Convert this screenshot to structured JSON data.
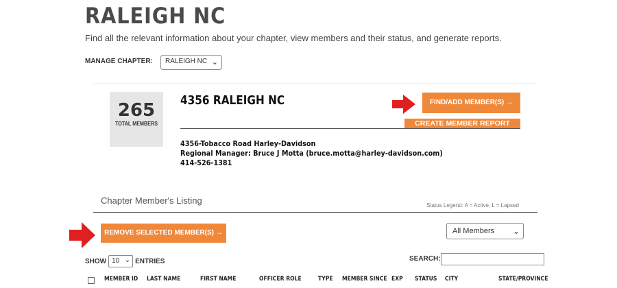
{
  "header": {
    "title": "RALEIGH NC",
    "description": "Find all the relevant information about your chapter, view members and their status, and generate reports."
  },
  "manage": {
    "label": "MANAGE CHAPTER:",
    "selected": "RALEIGH NC"
  },
  "stats": {
    "count": "265",
    "label": "TOTAL MEMBERS"
  },
  "chapter": {
    "name": "4356 RALEIGH NC",
    "dealer": "4356-Tobacco Road Harley-Davidson",
    "manager": "Regional Manager: Bruce J Motta (bruce.motta@harley-davidson.com)",
    "phone": "414-526-1381"
  },
  "actions": {
    "find_add": "FIND/ADD MEMBER(S) →",
    "create_report": "CREATE MEMBER REPORT",
    "remove_selected": "REMOVE SELECTED MEMBER(S) →"
  },
  "listing": {
    "title": "Chapter Member's Listing",
    "legend": "Status Legend: A = Active, L = Lapsed",
    "filter_selected": "All Members"
  },
  "table_controls": {
    "show_label": "SHOW",
    "entries_value": "10",
    "entries_label": "ENTRIES",
    "search_label": "SEARCH:",
    "search_value": ""
  },
  "columns": [
    "MEMBER ID",
    "LAST NAME",
    "FIRST NAME",
    "OFFICER ROLE",
    "TYPE",
    "MEMBER SINCE",
    "EXP",
    "STATUS",
    "CITY",
    "STATE/PROVINCE"
  ],
  "colors": {
    "accent_orange": "#f0883a",
    "arrow_red": "#e02020"
  },
  "icons": {
    "arrow_indicator": "red-arrow-icon",
    "dropdown": "chevron-down-icon"
  }
}
